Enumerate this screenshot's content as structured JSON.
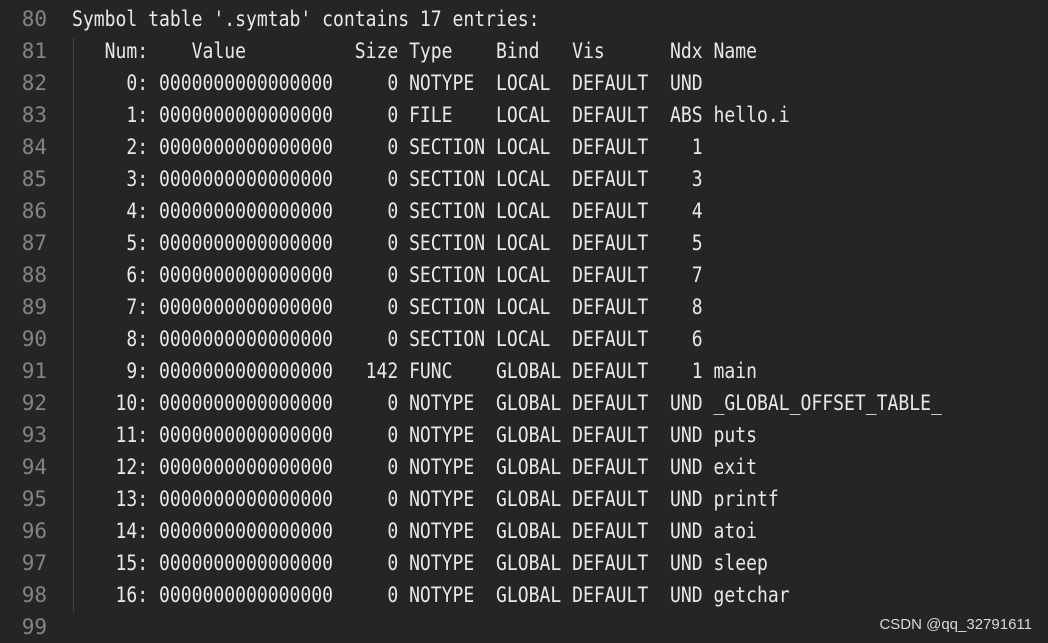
{
  "editor": {
    "line_numbers": [
      "80",
      "81",
      "82",
      "83",
      "84",
      "85",
      "86",
      "87",
      "88",
      "89",
      "90",
      "91",
      "92",
      "93",
      "94",
      "95",
      "96",
      "97",
      "98",
      "99"
    ],
    "lines": [
      "Symbol table '.symtab' contains 17 entries:",
      "   Num:    Value          Size Type    Bind   Vis      Ndx Name",
      "     0: 0000000000000000     0 NOTYPE  LOCAL  DEFAULT  UND",
      "     1: 0000000000000000     0 FILE    LOCAL  DEFAULT  ABS hello.i",
      "     2: 0000000000000000     0 SECTION LOCAL  DEFAULT    1",
      "     3: 0000000000000000     0 SECTION LOCAL  DEFAULT    3",
      "     4: 0000000000000000     0 SECTION LOCAL  DEFAULT    4",
      "     5: 0000000000000000     0 SECTION LOCAL  DEFAULT    5",
      "     6: 0000000000000000     0 SECTION LOCAL  DEFAULT    7",
      "     7: 0000000000000000     0 SECTION LOCAL  DEFAULT    8",
      "     8: 0000000000000000     0 SECTION LOCAL  DEFAULT    6",
      "     9: 0000000000000000   142 FUNC    GLOBAL DEFAULT    1 main",
      "    10: 0000000000000000     0 NOTYPE  GLOBAL DEFAULT  UND _GLOBAL_OFFSET_TABLE_",
      "    11: 0000000000000000     0 NOTYPE  GLOBAL DEFAULT  UND puts",
      "    12: 0000000000000000     0 NOTYPE  GLOBAL DEFAULT  UND exit",
      "    13: 0000000000000000     0 NOTYPE  GLOBAL DEFAULT  UND printf",
      "    14: 0000000000000000     0 NOTYPE  GLOBAL DEFAULT  UND atoi",
      "    15: 0000000000000000     0 NOTYPE  GLOBAL DEFAULT  UND sleep",
      "    16: 0000000000000000     0 NOTYPE  GLOBAL DEFAULT  UND getchar",
      ""
    ]
  },
  "watermark": "CSDN @qq_32791611",
  "colors": {
    "background": "#252525",
    "text": "#e8e8e8",
    "line_number": "#858585",
    "indent_guide": "#444444"
  }
}
